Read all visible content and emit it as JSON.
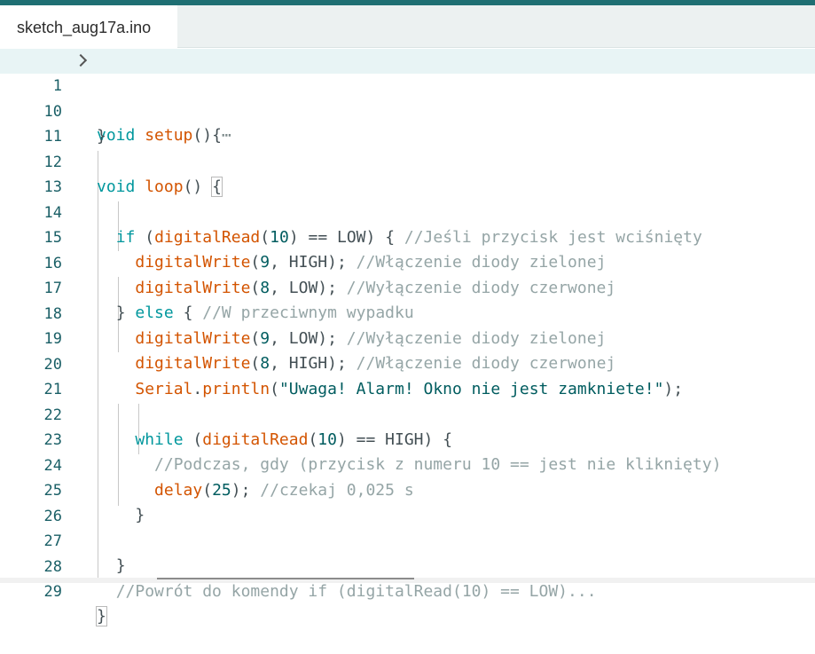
{
  "tab": {
    "label": "sketch_aug17a.ino"
  },
  "lines": [
    {
      "num": "1"
    },
    {
      "num": "10"
    },
    {
      "num": "11"
    },
    {
      "num": "12"
    },
    {
      "num": "13"
    },
    {
      "num": "14"
    },
    {
      "num": "15"
    },
    {
      "num": "16"
    },
    {
      "num": "17"
    },
    {
      "num": "18"
    },
    {
      "num": "19"
    },
    {
      "num": "20"
    },
    {
      "num": "21"
    },
    {
      "num": "22"
    },
    {
      "num": "23"
    },
    {
      "num": "24"
    },
    {
      "num": "25"
    },
    {
      "num": "26"
    },
    {
      "num": "27"
    },
    {
      "num": "28"
    },
    {
      "num": "29"
    }
  ],
  "tokens": {
    "void": "void",
    "setup": "setup",
    "setup_rest": "(){",
    "ellipsis": "⋯",
    "close_brace": "}",
    "loop": "loop",
    "loop_rest": "() ",
    "open_brace": "{",
    "if": "if",
    "digitalRead": "digitalRead",
    "digitalWrite": "digitalWrite",
    "delay": "delay",
    "while": "while",
    "serial": "Serial",
    "println": "println",
    "else": "else",
    "num10": "10",
    "num9": "9",
    "num8": "8",
    "num25": "25",
    "l14_eq": " == LOW) { ",
    "l14_comment": "//Jeśli przycisk jest wciśnięty",
    "l15_args": ", HIGH); ",
    "l15_comment": "//Włączenie diody zielonej",
    "l16_args": ", LOW); ",
    "l16_comment": "//Wyłączenie diody czerwonej",
    "l17_else_rest": " { ",
    "l17_comment": "//W przeciwnym wypadku",
    "l18_args": ", LOW); ",
    "l18_comment": "//Wyłączenie diody zielonej",
    "l19_args": ", HIGH); ",
    "l19_comment": "//Włączenie diody czerwonej",
    "l20_string": "\"Uwaga! Alarm! Okno nie jest zamkniete!\"",
    "l22_eq": " == HIGH) {",
    "l23_comment": "//Podczas, gdy (przycisk z numeru 10 == jest nie kliknięty)",
    "l24_comment": "//czekaj 0,025 s",
    "l28_comment": "//Powrót do komendy if (digitalRead(10) == LOW)..."
  }
}
